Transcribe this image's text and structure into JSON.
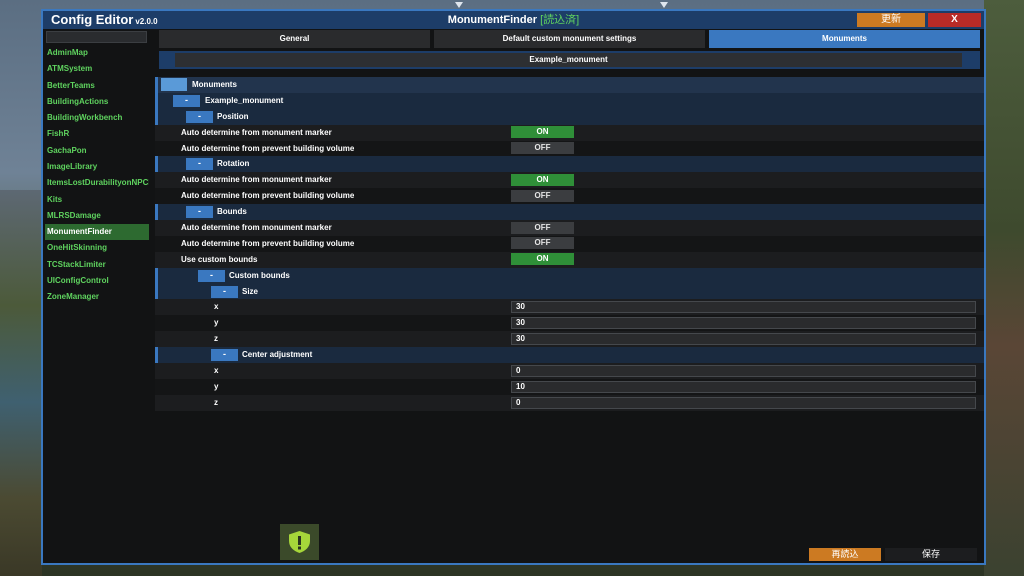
{
  "app": {
    "title": "Config Editor",
    "version": "v2.0.0",
    "plugin_name": "MonumentFinder",
    "load_status": "[読込済]",
    "update_label": "更新",
    "close_label": "X"
  },
  "sidebar": {
    "items": [
      {
        "label": "AdminMap"
      },
      {
        "label": "ATMSystem"
      },
      {
        "label": "BetterTeams"
      },
      {
        "label": "BuildingActions"
      },
      {
        "label": "BuildingWorkbench"
      },
      {
        "label": "FishR"
      },
      {
        "label": "GachaPon"
      },
      {
        "label": "ImageLibrary"
      },
      {
        "label": "ItemsLostDurabilityonNPCH"
      },
      {
        "label": "Kits"
      },
      {
        "label": "MLRSDamage"
      },
      {
        "label": "MonumentFinder",
        "active": true
      },
      {
        "label": "OneHitSkinning"
      },
      {
        "label": "TCStackLimiter"
      },
      {
        "label": "UIConfigControl"
      },
      {
        "label": "ZoneManager"
      }
    ]
  },
  "tabs": [
    {
      "label": "General"
    },
    {
      "label": "Default custom monument settings"
    },
    {
      "label": "Monuments",
      "active": true
    }
  ],
  "subtab": {
    "label": "Example_monument"
  },
  "tree": {
    "collapse_symbol": "-",
    "monuments": "Monuments",
    "example": "Example_monument",
    "position": {
      "label": "Position",
      "auto_marker": {
        "label": "Auto determine from monument marker",
        "value": "ON"
      },
      "auto_volume": {
        "label": "Auto determine from prevent building volume",
        "value": "OFF"
      }
    },
    "rotation": {
      "label": "Rotation",
      "auto_marker": {
        "label": "Auto determine from monument marker",
        "value": "ON"
      },
      "auto_volume": {
        "label": "Auto determine from prevent building volume",
        "value": "OFF"
      }
    },
    "bounds": {
      "label": "Bounds",
      "auto_marker": {
        "label": "Auto determine from monument marker",
        "value": "OFF"
      },
      "auto_volume": {
        "label": "Auto determine from prevent building volume",
        "value": "OFF"
      },
      "use_custom": {
        "label": "Use custom bounds",
        "value": "ON"
      },
      "custom_bounds": "Custom bounds",
      "size": {
        "label": "Size",
        "x": {
          "label": "x",
          "value": "30"
        },
        "y": {
          "label": "y",
          "value": "30"
        },
        "z": {
          "label": "z",
          "value": "30"
        }
      },
      "center": {
        "label": "Center adjustment",
        "x": {
          "label": "x",
          "value": "0"
        },
        "y": {
          "label": "y",
          "value": "10"
        },
        "z": {
          "label": "z",
          "value": "0"
        }
      }
    }
  },
  "footer": {
    "reload_label": "再読込",
    "save_label": "保存"
  },
  "icons": {
    "notice": "shield-alert-icon"
  },
  "colors": {
    "accent": "#3a78c0",
    "on": "#2f8f38",
    "off": "#3b3d40",
    "plugin_text": "#5fd35f",
    "update": "#cc7a22",
    "close": "#b92b27"
  }
}
